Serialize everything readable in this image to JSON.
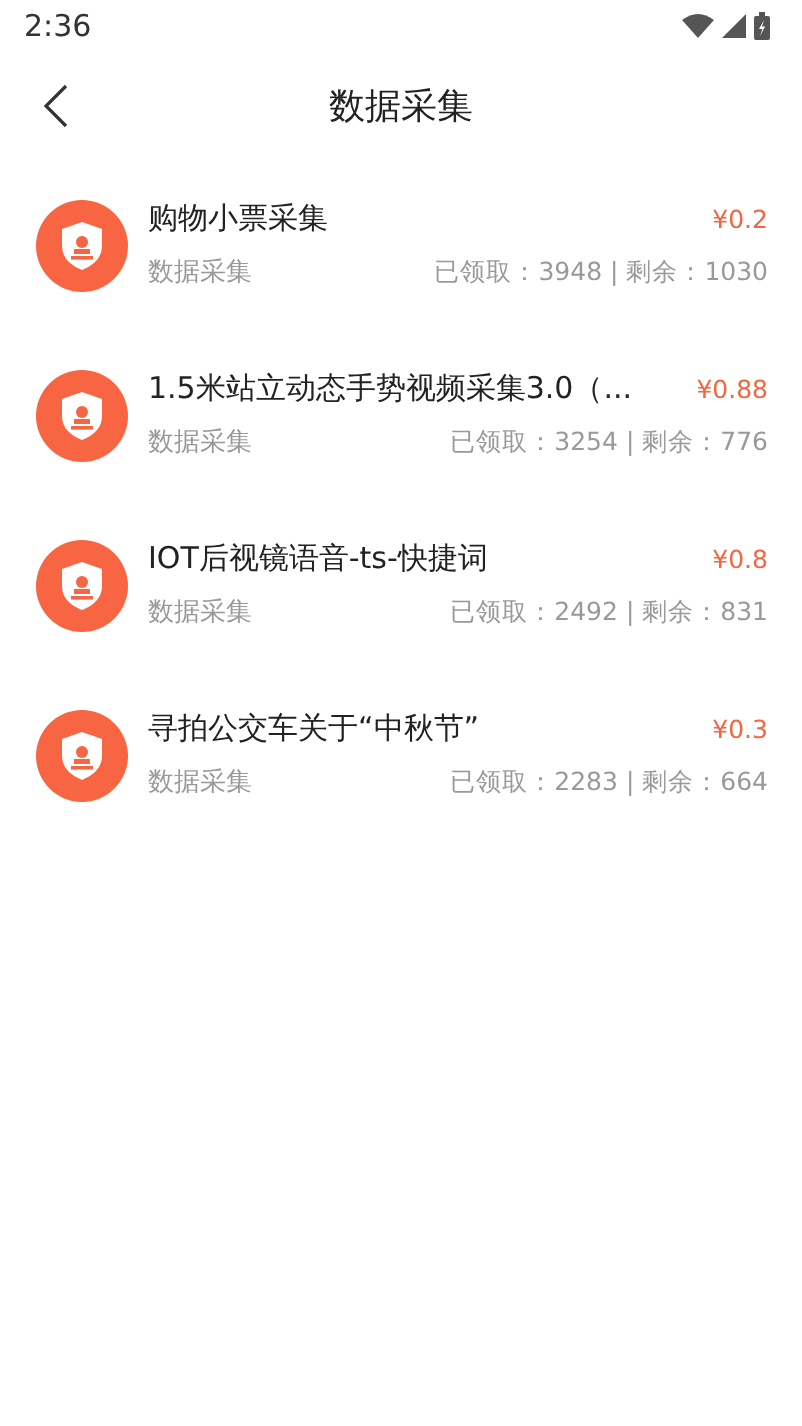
{
  "status_bar": {
    "time": "2:36"
  },
  "header": {
    "title": "数据采集"
  },
  "tasks": [
    {
      "title": "购物小票采集",
      "category": "数据采集",
      "price": "¥0.2",
      "stats": "已领取：3948 | 剩余：1030"
    },
    {
      "title": "1.5米站立动态手势视频采集3.0（...",
      "category": "数据采集",
      "price": "¥0.88",
      "stats": "已领取：3254 | 剩余：776"
    },
    {
      "title": "IOT后视镜语音-ts-快捷词",
      "category": "数据采集",
      "price": "¥0.8",
      "stats": "已领取：2492 | 剩余：831"
    },
    {
      "title": "寻拍公交车关于“中秋节”",
      "category": "数据采集",
      "price": "¥0.3",
      "stats": "已领取：2283 | 剩余：664"
    }
  ]
}
